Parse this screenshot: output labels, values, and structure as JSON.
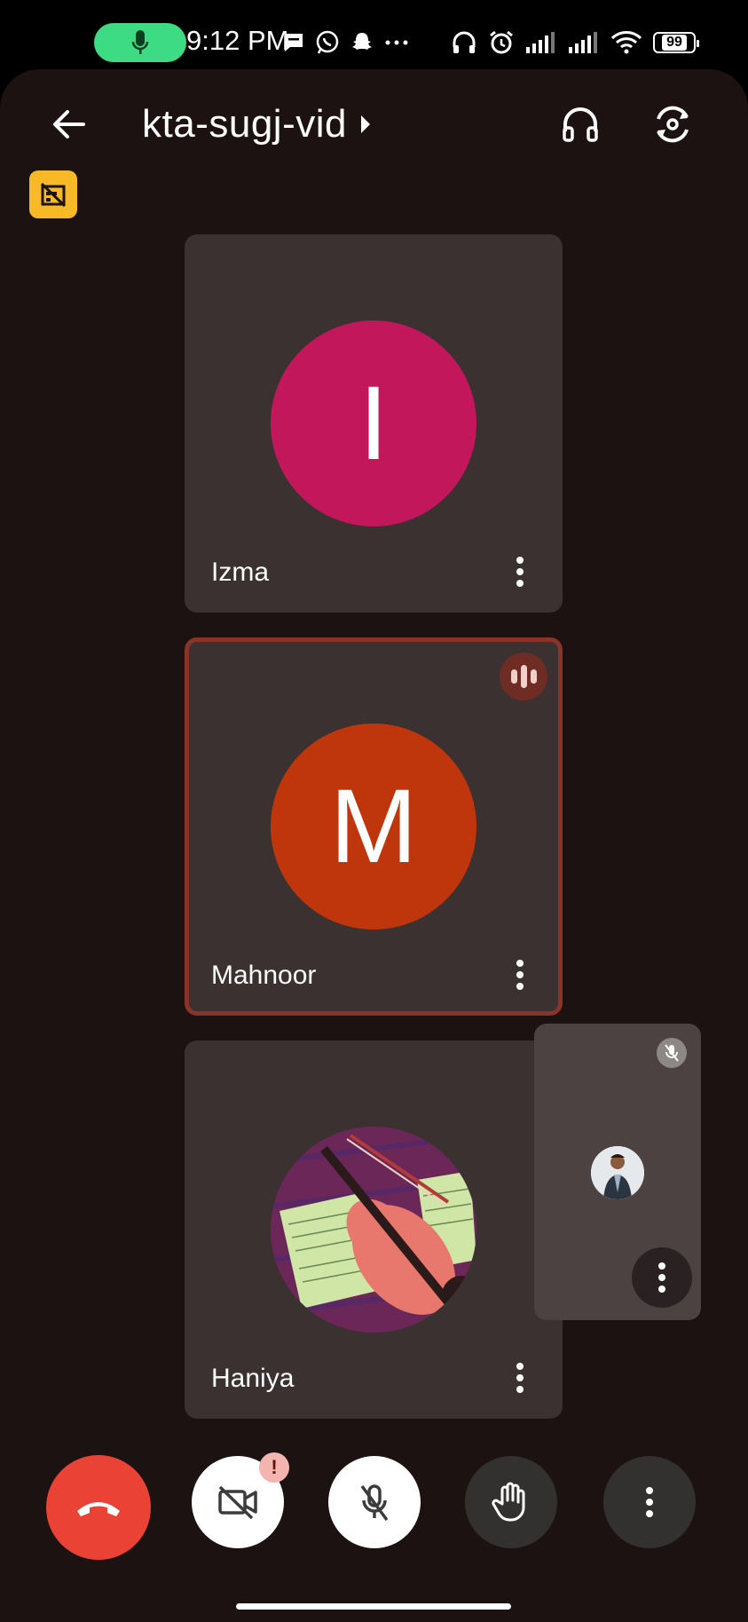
{
  "status_bar": {
    "time": "9:12 PM",
    "battery": "99",
    "icons": [
      "mic-active-icon",
      "message-icon",
      "whatsapp-icon",
      "snapchat-icon",
      "more-dots-icon",
      "headphones-icon",
      "alarm-icon",
      "signal-icon",
      "signal-icon",
      "wifi-icon",
      "battery-icon"
    ],
    "mic_pill_color": "#3ddc84"
  },
  "header": {
    "meeting_code": "kta-sugj-vid",
    "actions": [
      "back-arrow-icon",
      "headset-icon",
      "flip-camera-icon"
    ],
    "no_recording_badge_color": "#f7b928"
  },
  "participants": [
    {
      "name": "Izma",
      "initial": "I",
      "avatar_color": "#c2185b",
      "speaking": false
    },
    {
      "name": "Mahnoor",
      "initial": "M",
      "avatar_color": "#bf360c",
      "speaking": true
    },
    {
      "name": "Haniya",
      "initial": "",
      "avatar_type": "violin-photo",
      "speaking": false
    }
  ],
  "self_view": {
    "muted": true
  },
  "controls": {
    "end_call_color": "#ea4335",
    "camera_alert": "!",
    "items": [
      "end-call",
      "camera-off",
      "mic-off",
      "raise-hand",
      "more-options"
    ]
  }
}
